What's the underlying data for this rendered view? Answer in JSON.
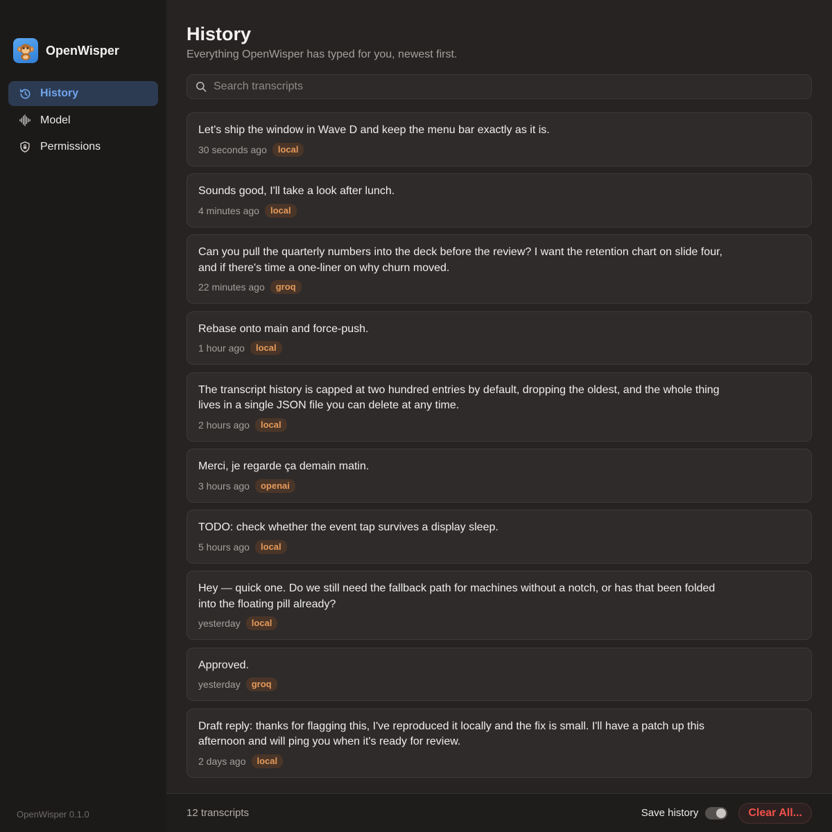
{
  "app": {
    "name": "OpenWisper",
    "version": "OpenWisper 0.1.0"
  },
  "nav": [
    {
      "label": "History",
      "icon": "history-icon",
      "active": true
    },
    {
      "label": "Model",
      "icon": "waveform-icon",
      "active": false
    },
    {
      "label": "Permissions",
      "icon": "shield-icon",
      "active": false
    }
  ],
  "header": {
    "title": "History",
    "subtitle": "Everything OpenWisper has typed for you, newest first."
  },
  "search": {
    "placeholder": "Search transcripts",
    "value": ""
  },
  "transcripts": [
    {
      "text": "Let's ship the window in Wave D and keep the menu bar exactly as it is.",
      "time": "30 seconds ago",
      "source": "local"
    },
    {
      "text": "Sounds good, I'll take a look after lunch.",
      "time": "4 minutes ago",
      "source": "local"
    },
    {
      "text": "Can you pull the quarterly numbers into the deck before the review? I want the retention chart on slide four, and if there's time a one-liner on why churn moved.",
      "time": "22 minutes ago",
      "source": "groq"
    },
    {
      "text": "Rebase onto main and force-push.",
      "time": "1 hour ago",
      "source": "local"
    },
    {
      "text": "The transcript history is capped at two hundred entries by default, dropping the oldest, and the whole thing lives in a single JSON file you can delete at any time.",
      "time": "2 hours ago",
      "source": "local"
    },
    {
      "text": "Merci, je regarde ça demain matin.",
      "time": "3 hours ago",
      "source": "openai"
    },
    {
      "text": "TODO: check whether the event tap survives a display sleep.",
      "time": "5 hours ago",
      "source": "local"
    },
    {
      "text": "Hey — quick one. Do we still need the fallback path for machines without a notch, or has that been folded into the floating pill already?",
      "time": "yesterday",
      "source": "local"
    },
    {
      "text": "Approved.",
      "time": "yesterday",
      "source": "groq"
    },
    {
      "text": "Draft reply: thanks for flagging this, I've reproduced it locally and the fix is small. I'll have a patch up this afternoon and will ping you when it's ready for review.",
      "time": "2 days ago",
      "source": "local"
    }
  ],
  "footer": {
    "count": "12 transcripts",
    "save_history_label": "Save history",
    "save_history_on": true,
    "clear_label": "Clear All..."
  },
  "colors": {
    "accent": "#72a6ee",
    "badge": "#e59a5a",
    "danger": "#f0504a"
  }
}
